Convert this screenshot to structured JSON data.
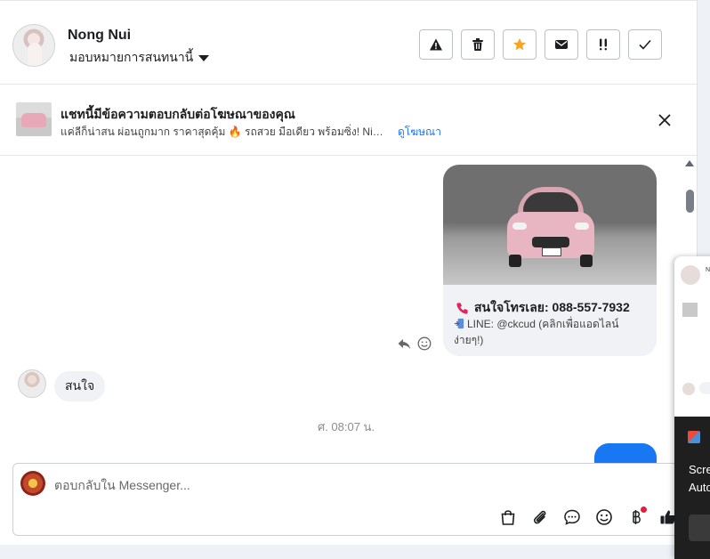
{
  "header": {
    "contact_name": "Nong Nui",
    "assign_label": "มอบหมายการสนทนานี้",
    "actions": [
      {
        "name": "report-button",
        "icon": "warning-icon"
      },
      {
        "name": "delete-button",
        "icon": "trash-icon"
      },
      {
        "name": "star-button",
        "icon": "star-icon"
      },
      {
        "name": "mark-unread-button",
        "icon": "envelope-icon"
      },
      {
        "name": "follow-up-button",
        "icon": "double-exclamation-icon"
      },
      {
        "name": "mark-done-button",
        "icon": "check-icon"
      }
    ]
  },
  "ad_banner": {
    "title": "แชทนี้มีข้อความตอบกลับต่อโฆษณาของคุณ",
    "description": "แค่ลีก็น่าสน ผ่อนถูกมาก ราคาสุดคุ้ม 🔥 รถสวย มือเดียว พร้อมซิ่ง! Nissan ...",
    "link_label": "ดูโฆษณา"
  },
  "thread": {
    "card": {
      "phone_text": "สนใจโทรเลย: 088-557-7932",
      "line_text": "LINE: @ckcud (คลิกเพื่อแอดไลน์ง่ายๆ!)"
    },
    "incoming_message": "สนใจ",
    "timestamp": "ศ. 08:07 น."
  },
  "composer": {
    "placeholder": "ตอบกลับใน Messenger...",
    "tools": [
      "shopping-bag-icon",
      "paperclip-icon",
      "chat-bubble-icon",
      "emoji-icon",
      "baht-icon",
      "thumbs-up-icon"
    ]
  },
  "overlay": {
    "mini_name": "N",
    "line1": "Scre",
    "line2": "Auto"
  },
  "colors": {
    "accent": "#1877f2",
    "star": "#f5a623",
    "badge": "#e41e3f"
  }
}
